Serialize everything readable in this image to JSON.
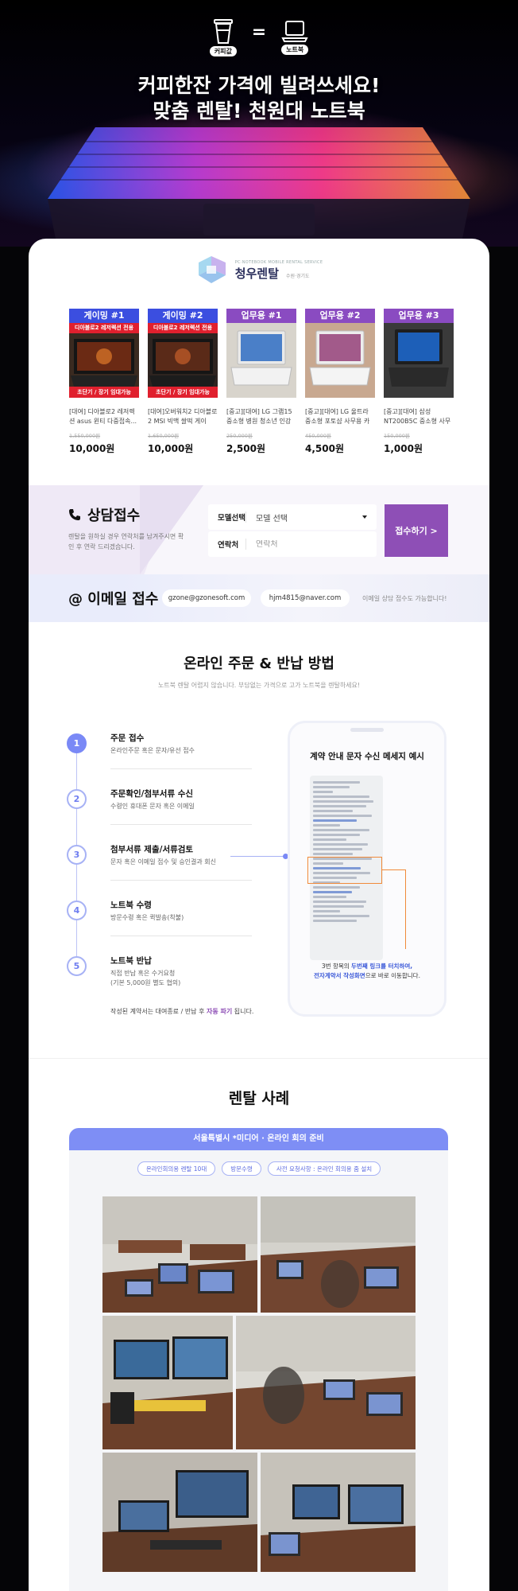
{
  "hero": {
    "icon_left_label": "커피값",
    "equals": "=",
    "icon_right_label": "노트북",
    "title_line1": "커피한잔 가격에 빌려쓰세요!",
    "title_line2": "맞춤 렌탈! 천원대 노트북"
  },
  "logo": {
    "subtitle": "PC·NOTEBOOK MOBILE RENTAL SERVICE",
    "name": "청우렌탈",
    "small": "수원·경기도"
  },
  "products": [
    {
      "badge": "게이밍 #1",
      "badge_color": "#3b4ee0",
      "red_top": "디아블로2 레저렉션 전용",
      "red_bottom": "초단기 / 장기 임대가능",
      "desc": "[대여] 디아블로2 레저렉션 asus 윈티 다중접속...",
      "old_price": "1,550,000원",
      "price": "10,000원"
    },
    {
      "badge": "게이밍 #2",
      "badge_color": "#3b4ee0",
      "red_top": "디아블로2 레저렉션 전용",
      "red_bottom": "초단기 / 장기 임대가능",
      "desc": "[대여]오버워치2 디아블로2 MSI 빅맥 쌀떡 게이밍...",
      "old_price": "1,650,000원",
      "price": "10,000원"
    },
    {
      "badge": "업무용 #1",
      "badge_color": "#8a4bc1",
      "red_top": "",
      "red_bottom": "",
      "desc": "[중고][대여] LG 그램15 중소형 병원 청소년 인강용...",
      "old_price": "250,000원",
      "price": "2,500원"
    },
    {
      "badge": "업무용 #2",
      "badge_color": "#8a4bc1",
      "red_top": "",
      "red_bottom": "",
      "desc": "[중고][대여] LG 울트라 중소형 포토샵 사무용 카페...",
      "old_price": "450,000원",
      "price": "4,500원"
    },
    {
      "badge": "업무용 #3",
      "badge_color": "#8a4bc1",
      "red_top": "",
      "red_bottom": "",
      "desc": "[중고][대여] 삼성 NT200B5C 중소형 사무용 카페...",
      "old_price": "150,000원",
      "price": "1,000원"
    }
  ],
  "consult": {
    "title": "상담접수",
    "desc": "렌탈을 원하실 경우 연락처를 남겨주시면 확인 후 연락 드리겠습니다.",
    "model_label": "모델선택",
    "model_value": "모델 선택",
    "contact_label": "연락처",
    "contact_placeholder": "연락처",
    "submit": "접수하기 >"
  },
  "email": {
    "title": "@ 이메일 접수",
    "address1": "gzone@gzonesoft.com",
    "address2": "hjm4815@naver.com",
    "note": "이메일 상담 접수도 가능합니다!"
  },
  "order": {
    "title": "온라인 주문 & 반납 방법",
    "subtitle": "노트북 렌탈 어렵지 않습니다. 부담없는 가격으로 고가 노트북을 렌탈하세요!",
    "steps": [
      {
        "num": "1",
        "title": "주문 접수",
        "desc": "온라인주문 혹은 문자/유선 접수"
      },
      {
        "num": "2",
        "title": "주문확인/첨부서류 수신",
        "desc": "수령인 휴대폰 문자 혹은 이메일"
      },
      {
        "num": "3",
        "title": "첨부서류 제출/서류검토",
        "desc": "문자 혹은 이메일 접수 및 승인결과 회신"
      },
      {
        "num": "4",
        "title": "노트북 수령",
        "desc": "방문수령 혹은 퀵발송(착불)"
      },
      {
        "num": "5",
        "title": "노트북 반납",
        "desc": "직접 반납 혹은 수거요청\n(기본 5,000원 별도 협의)"
      }
    ],
    "note_prefix": "작성된 계약서는 대여종료 / 반납 후 ",
    "note_strong": "자동 파기",
    "note_suffix": " 됩니다.",
    "phone_title": "계약 안내 문자 수신 메세지 예시",
    "caption_prefix": "3번 항목의 ",
    "caption_link": "두번째 링크를 터치하여,",
    "caption_middle": "전자계약서 작성화면",
    "caption_suffix": "으로 바로 이동합니다."
  },
  "cases": {
    "title": "렌탈 사례",
    "bar": "서울특별시 *미디어 · 온라인 회의 준비",
    "tags": [
      "온라인회의용 렌탈 10대",
      "방문수령",
      "사전 요청사항 : 온라인 회의용 줌 설치"
    ]
  },
  "colors": {
    "accent_purple": "#8e4fb6",
    "accent_blue": "#7e8ef5",
    "badge_blue": "#3b4ee0",
    "badge_purple": "#8a4bc1",
    "sale_red": "#e0202e"
  }
}
